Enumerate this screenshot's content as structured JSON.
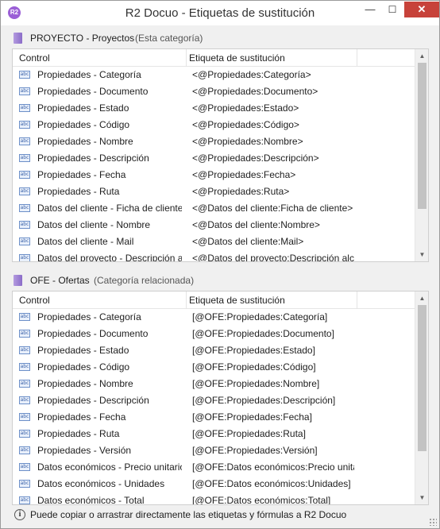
{
  "window": {
    "title": "R2 Docuo - Etiquetas de sustitución",
    "app_icon_text": "R2",
    "controls": {
      "minimize": "—",
      "maximize": "☐",
      "close": "✕"
    }
  },
  "columns": {
    "control": "Control",
    "tag": "Etiqueta de sustitución"
  },
  "row_icon_text": "abc",
  "sections": [
    {
      "name": "PROYECTO - Proyectos",
      "note": "(Esta categoría)",
      "rows": [
        {
          "control": "Propiedades - Categoría",
          "tag": "<@Propiedades:Categoría>"
        },
        {
          "control": "Propiedades - Documento",
          "tag": "<@Propiedades:Documento>"
        },
        {
          "control": "Propiedades - Estado",
          "tag": "<@Propiedades:Estado>"
        },
        {
          "control": "Propiedades - Código",
          "tag": "<@Propiedades:Código>"
        },
        {
          "control": "Propiedades - Nombre",
          "tag": "<@Propiedades:Nombre>"
        },
        {
          "control": "Propiedades - Descripción",
          "tag": "<@Propiedades:Descripción>"
        },
        {
          "control": "Propiedades - Fecha",
          "tag": "<@Propiedades:Fecha>"
        },
        {
          "control": "Propiedades - Ruta",
          "tag": "<@Propiedades:Ruta>"
        },
        {
          "control": "Datos del cliente - Ficha de cliente",
          "tag": "<@Datos del cliente:Ficha de cliente>"
        },
        {
          "control": "Datos del cliente - Nombre",
          "tag": "<@Datos del cliente:Nombre>"
        },
        {
          "control": "Datos del cliente - Mail",
          "tag": "<@Datos del cliente:Mail>"
        },
        {
          "control": "Datos del proyecto - Descripción a",
          "tag": "<@Datos del proyecto:Descripción alc"
        }
      ]
    },
    {
      "name": "OFE - Ofertas",
      "note": "(Categoría relacionada)",
      "rows": [
        {
          "control": "Propiedades - Categoría",
          "tag": "[@OFE:Propiedades:Categoría]"
        },
        {
          "control": "Propiedades - Documento",
          "tag": "[@OFE:Propiedades:Documento]"
        },
        {
          "control": "Propiedades - Estado",
          "tag": "[@OFE:Propiedades:Estado]"
        },
        {
          "control": "Propiedades - Código",
          "tag": "[@OFE:Propiedades:Código]"
        },
        {
          "control": "Propiedades - Nombre",
          "tag": "[@OFE:Propiedades:Nombre]"
        },
        {
          "control": "Propiedades - Descripción",
          "tag": "[@OFE:Propiedades:Descripción]"
        },
        {
          "control": "Propiedades - Fecha",
          "tag": "[@OFE:Propiedades:Fecha]"
        },
        {
          "control": "Propiedades - Ruta",
          "tag": "[@OFE:Propiedades:Ruta]"
        },
        {
          "control": "Propiedades - Versión",
          "tag": "[@OFE:Propiedades:Versión]"
        },
        {
          "control": "Datos económicos - Precio unitario",
          "tag": "[@OFE:Datos económicos:Precio unita"
        },
        {
          "control": "Datos económicos - Unidades",
          "tag": "[@OFE:Datos económicos:Unidades]"
        },
        {
          "control": "Datos económicos - Total",
          "tag": "[@OFE:Datos económicos:Total]"
        }
      ]
    }
  ],
  "status": {
    "text": "Puede copiar o arrastrar directamente las etiquetas y fórmulas a R2 Docuo"
  },
  "icons": {
    "folder": "folder-icon",
    "text_field": "abc-icon",
    "info": "info-icon"
  },
  "colors": {
    "close_button": "#c7423a",
    "folder": "#8a6cc8",
    "app_icon": "#9b5fd6"
  }
}
